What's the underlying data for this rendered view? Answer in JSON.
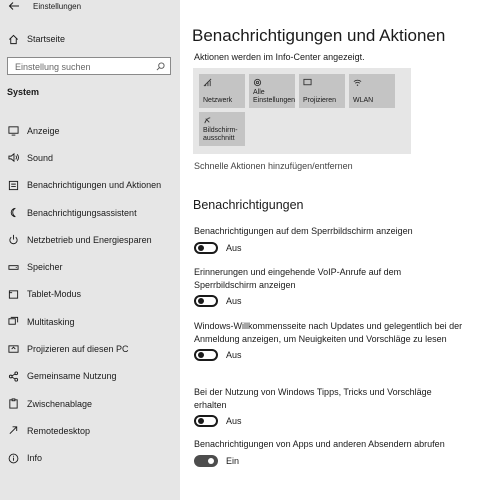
{
  "window": {
    "title": "Einstellungen"
  },
  "sidebar": {
    "home_label": "Startseite",
    "search_placeholder": "Einstellung suchen",
    "section": "System",
    "items": [
      {
        "label": "Anzeige",
        "icon": "monitor-icon"
      },
      {
        "label": "Sound",
        "icon": "speaker-icon"
      },
      {
        "label": "Benachrichtigungen und Aktionen",
        "icon": "notification-icon"
      },
      {
        "label": "Benachrichtigungsassistent",
        "icon": "moon-icon"
      },
      {
        "label": "Netzbetrieb und Energiesparen",
        "icon": "power-icon"
      },
      {
        "label": "Speicher",
        "icon": "storage-icon"
      },
      {
        "label": "Tablet-Modus",
        "icon": "tablet-icon"
      },
      {
        "label": "Multitasking",
        "icon": "multitasking-icon"
      },
      {
        "label": "Projizieren auf diesen PC",
        "icon": "project-icon"
      },
      {
        "label": "Gemeinsame Nutzung",
        "icon": "share-icon"
      },
      {
        "label": "Zwischenablage",
        "icon": "clipboard-icon"
      },
      {
        "label": "Remotedesktop",
        "icon": "remote-desktop-icon"
      },
      {
        "label": "Info",
        "icon": "info-icon"
      }
    ]
  },
  "main": {
    "title": "Benachrichtigungen und Aktionen",
    "quick_actions_caption": "Aktionen werden im Info-Center angezeigt.",
    "tiles": [
      {
        "label": "Netzwerk",
        "icon": "network-icon"
      },
      {
        "label": "Alle Einstellungen",
        "icon": "gear-icon"
      },
      {
        "label": "Projizieren",
        "icon": "project-icon"
      },
      {
        "label": "WLAN",
        "icon": "wifi-icon"
      },
      {
        "label": "Bildschirm-ausschnitt",
        "icon": "snip-icon"
      }
    ],
    "quick_actions_link": "Schnelle Aktionen hinzufügen/entfernen",
    "notifications_heading": "Benachrichtigungen",
    "settings": [
      {
        "label": "Benachrichtigungen auf dem Sperrbildschirm anzeigen",
        "state": "Aus",
        "on": false
      },
      {
        "label": "Erinnerungen und eingehende VoIP-Anrufe auf dem Sperrbildschirm anzeigen",
        "state": "Aus",
        "on": false
      },
      {
        "label": "Windows-Willkommensseite nach Updates und gelegentlich bei der Anmeldung anzeigen, um Neuigkeiten und Vorschläge zu lesen",
        "state": "Aus",
        "on": false
      },
      {
        "label": "Bei der Nutzung von Windows Tipps, Tricks und Vorschläge erhalten",
        "state": "Aus",
        "on": false
      },
      {
        "label": "Benachrichtigungen von Apps und anderen Absendern abrufen",
        "state": "Ein",
        "on": true
      }
    ]
  },
  "colors": {
    "sidebar_bg": "#e6e6e6",
    "tile_bg": "#c4c4c4",
    "toggle_on": "#4d4d4d"
  }
}
